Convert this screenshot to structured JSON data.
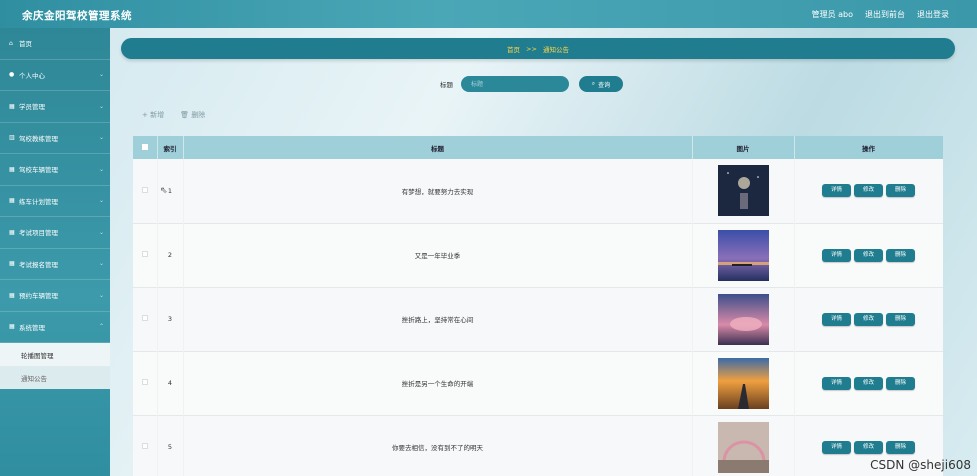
{
  "header": {
    "title": "余庆金阳驾校管理系统",
    "links": [
      "管理员 abo",
      "退出到前台",
      "退出登录"
    ]
  },
  "sidebar": {
    "items": [
      {
        "label": "首页",
        "icon": "home-icon"
      },
      {
        "label": "个人中心",
        "icon": "person-icon"
      },
      {
        "label": "学员管理",
        "icon": "grid-icon"
      },
      {
        "label": "驾校教练管理",
        "icon": "chart-icon"
      },
      {
        "label": "驾校车辆管理",
        "icon": "grid-icon"
      },
      {
        "label": "练车计划管理",
        "icon": "grid-icon"
      },
      {
        "label": "考试项目管理",
        "icon": "grid-icon"
      },
      {
        "label": "考试报名管理",
        "icon": "grid-icon"
      },
      {
        "label": "预约车辆管理",
        "icon": "grid-icon"
      },
      {
        "label": "系统管理",
        "icon": "grid-icon"
      }
    ],
    "sub_items": [
      "轮播图管理",
      "通知公告"
    ]
  },
  "breadcrumb": {
    "home": "首页",
    "separator": ">>",
    "current": "通知公告"
  },
  "search": {
    "label": "标题",
    "placeholder": "标题",
    "button": "查询"
  },
  "actions": {
    "add": "+ 新增",
    "delete": "删除"
  },
  "table": {
    "headers": [
      "",
      "索引",
      "标题",
      "图片",
      "操作"
    ],
    "rows": [
      {
        "index": "1",
        "title": "有梦想，就要努力去实现"
      },
      {
        "index": "2",
        "title": "又是一年毕业季"
      },
      {
        "index": "3",
        "title": "挫折路上，坚持常在心间"
      },
      {
        "index": "4",
        "title": "挫折是另一个生命的开端"
      },
      {
        "index": "5",
        "title": "你要去相信，没有到不了的明天"
      }
    ],
    "row_buttons": [
      "详情",
      "修改",
      "删除"
    ]
  },
  "watermark": "CSDN @sheji608",
  "colors": {
    "primary": "#1f7d8f",
    "breadcrumb_text": "#ffd54a",
    "header_row": "#9fcfd9"
  }
}
